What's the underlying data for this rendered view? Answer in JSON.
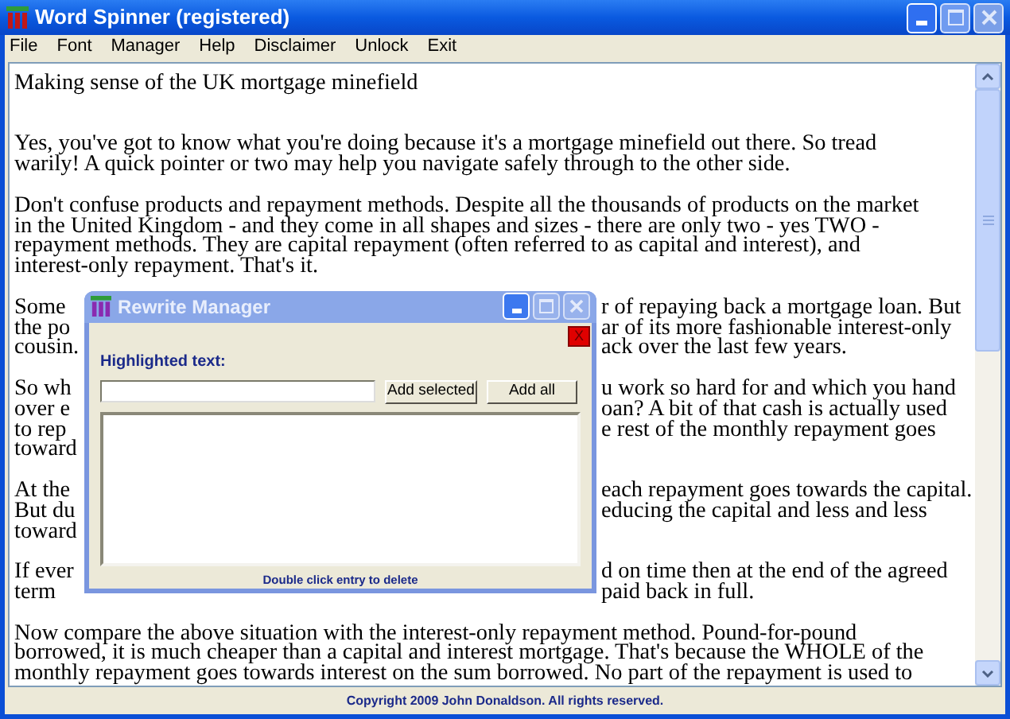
{
  "window": {
    "title": "Word Spinner (registered)"
  },
  "menu": [
    "File",
    "Font",
    "Manager",
    "Help",
    "Disclaimer",
    "Unlock",
    "Exit"
  ],
  "document": {
    "paragraphs": [
      {
        "kind": "heading",
        "lines": [
          {
            "left": "Making sense of the UK mortgage minefield"
          }
        ]
      },
      {
        "kind": "text",
        "lines": [
          {
            "left": "Yes, you've got to know what you're doing because it's a mortgage minefield out there. So tread"
          },
          {
            "left": "warily! A quick pointer or two may help you navigate safely through to the other side."
          }
        ]
      },
      {
        "kind": "text",
        "lines": [
          {
            "left": "Don't confuse products and repayment methods. Despite all the thousands of products on the market"
          },
          {
            "left": "in the United Kingdom - and they come in all shapes and sizes - there are only two - yes TWO -"
          },
          {
            "left": "repayment methods. They are capital repayment (often referred to as capital and interest), and"
          },
          {
            "left": "interest-only repayment. That's it."
          }
        ]
      },
      {
        "kind": "text",
        "lines": [
          {
            "left": "Some",
            "right": "r of repaying back a mortgage loan. But"
          },
          {
            "left": "the po",
            "right": "ar of its more fashionable interest-only"
          },
          {
            "left": "cousin.",
            "right": "ack over the last few years."
          }
        ]
      },
      {
        "kind": "text",
        "lines": [
          {
            "left": "So wh",
            "right": "u work so hard for and which you hand"
          },
          {
            "left": "over e",
            "right": "oan? A bit of that cash is actually used"
          },
          {
            "left": "to rep",
            "right": "e rest of the monthly repayment goes"
          },
          {
            "left": "toward"
          }
        ]
      },
      {
        "kind": "text",
        "lines": [
          {
            "left": "At the",
            "right": "each repayment goes towards the capital."
          },
          {
            "left": "But du",
            "right": "educing the capital and less and less"
          },
          {
            "left": "toward"
          }
        ]
      },
      {
        "kind": "text",
        "lines": [
          {
            "left": "If ever",
            "right": "d on time then at the end of the agreed"
          },
          {
            "left": "term",
            "right": "paid back in full."
          }
        ]
      },
      {
        "kind": "text",
        "lines": [
          {
            "left": "Now compare the above situation with the interest-only repayment method. Pound-for-pound"
          },
          {
            "left": "borrowed, it is much cheaper than a capital and interest mortgage. That's because the WHOLE of the"
          },
          {
            "left": "monthly repayment goes towards interest on the sum borrowed. No part of the repayment is used to"
          }
        ]
      }
    ]
  },
  "dialog": {
    "title": "Rewrite Manager",
    "close_glyph": "X",
    "label": "Highlighted text:",
    "buttons": [
      "Add selected",
      "Add all"
    ],
    "hint": "Double click entry to delete"
  },
  "status_bar": "Copyright 2009 John Donaldson. All rights reserved."
}
